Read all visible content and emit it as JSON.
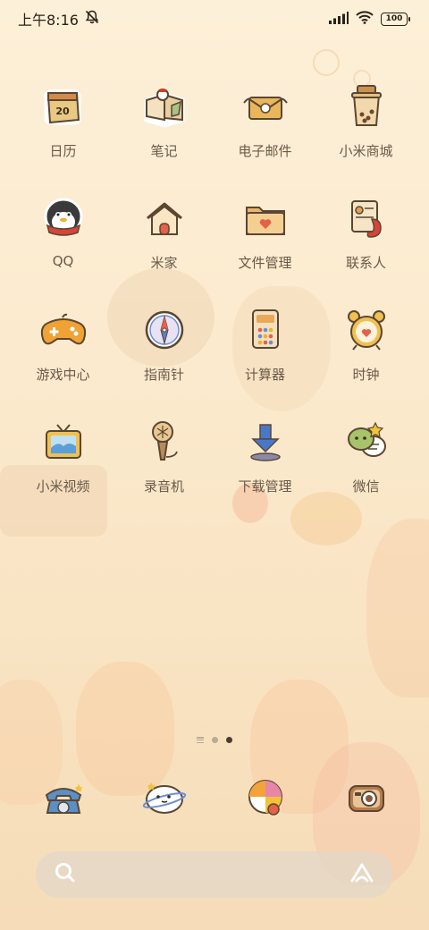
{
  "status_bar": {
    "time": "上午8:16",
    "battery": "100"
  },
  "apps": [
    {
      "label": "日历",
      "icon": "calendar-icon",
      "badge": "20"
    },
    {
      "label": "笔记",
      "icon": "notes-icon"
    },
    {
      "label": "电子邮件",
      "icon": "email-icon"
    },
    {
      "label": "小米商城",
      "icon": "store-icon"
    },
    {
      "label": "QQ",
      "icon": "qq-icon"
    },
    {
      "label": "米家",
      "icon": "home-icon"
    },
    {
      "label": "文件管理",
      "icon": "folder-icon"
    },
    {
      "label": "联系人",
      "icon": "contacts-icon"
    },
    {
      "label": "游戏中心",
      "icon": "gamepad-icon"
    },
    {
      "label": "指南针",
      "icon": "compass-icon"
    },
    {
      "label": "计算器",
      "icon": "calculator-icon"
    },
    {
      "label": "时钟",
      "icon": "clock-icon"
    },
    {
      "label": "小米视频",
      "icon": "tv-icon"
    },
    {
      "label": "录音机",
      "icon": "microphone-icon"
    },
    {
      "label": "下载管理",
      "icon": "download-icon"
    },
    {
      "label": "微信",
      "icon": "wechat-icon"
    }
  ],
  "dock": [
    {
      "icon": "phone-icon"
    },
    {
      "icon": "messages-icon"
    },
    {
      "icon": "browser-icon"
    },
    {
      "icon": "camera-icon"
    }
  ],
  "page_indicator": {
    "pages": 3,
    "active": 3
  },
  "colors": {
    "background": "#fbe9cc",
    "label": "#6a5a4a",
    "outline": "#5a4632"
  }
}
